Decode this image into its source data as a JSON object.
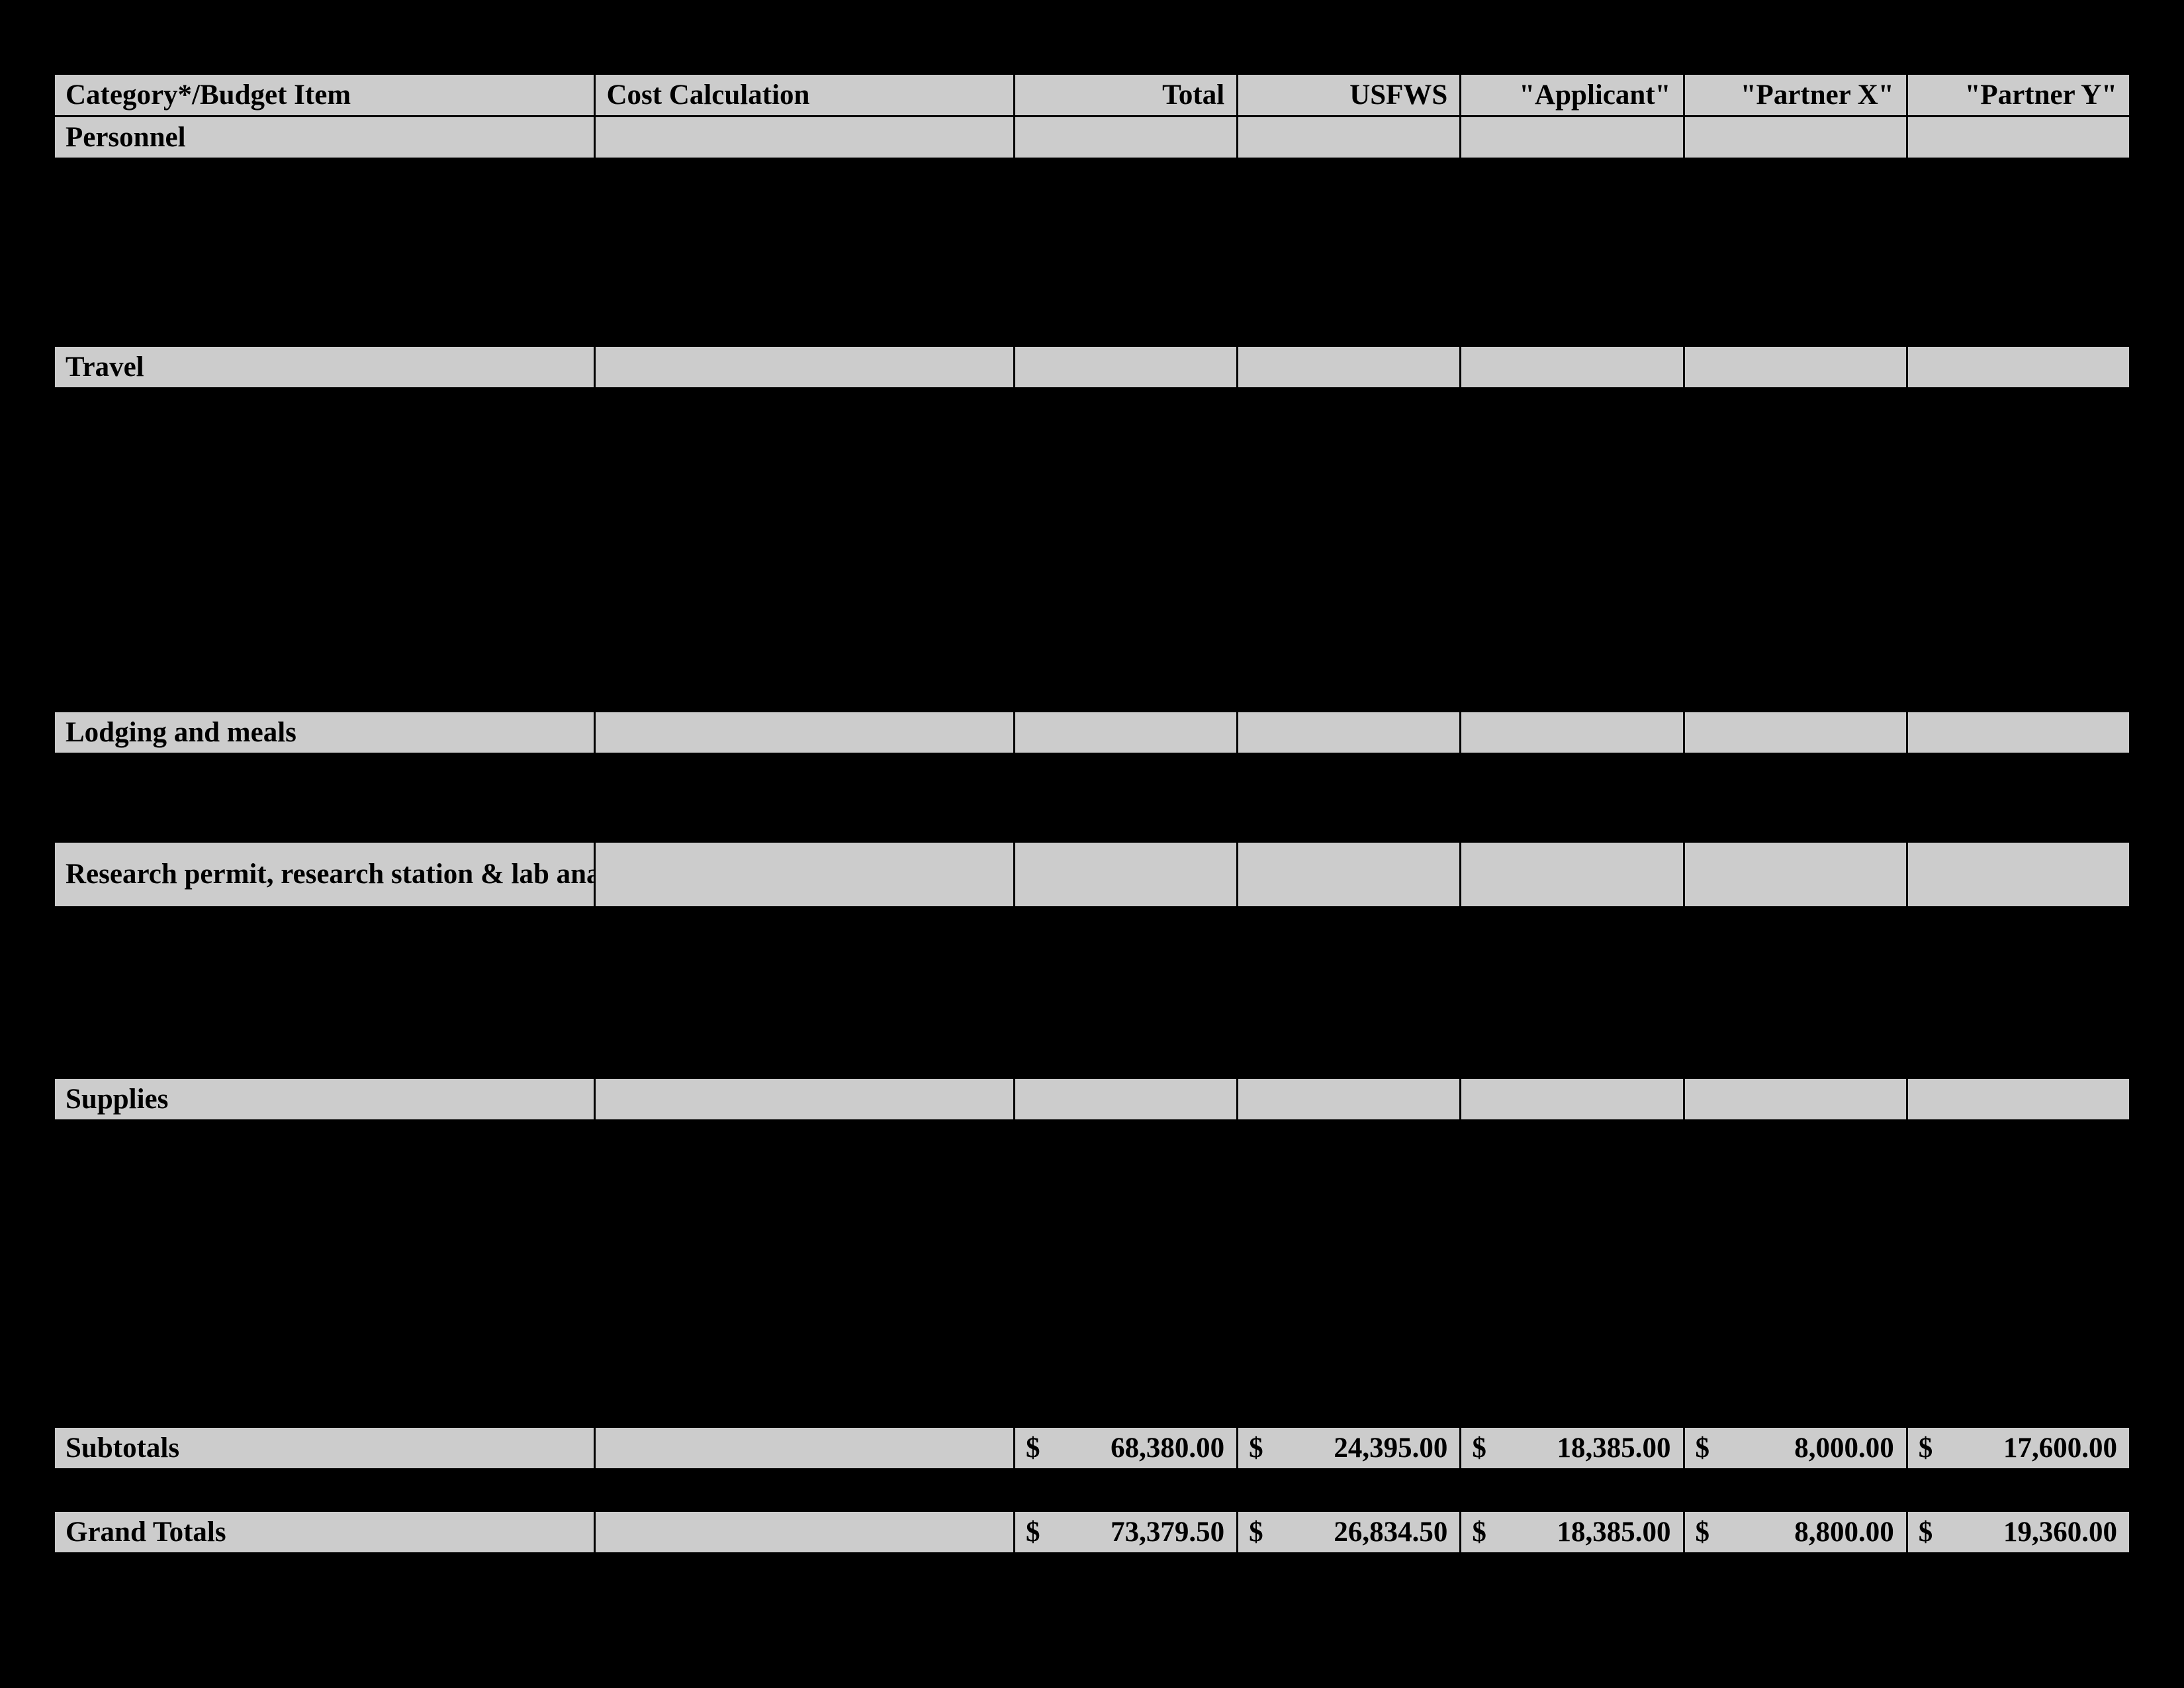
{
  "headers": {
    "category": "Category*/Budget Item",
    "calc": "Cost Calculation",
    "total": "Total",
    "usfws": "USFWS",
    "applicant": "\"Applicant\"",
    "partnerX": "\"Partner X\"",
    "partnerY": "\"Partner Y\""
  },
  "sections": {
    "personnel": "Personnel",
    "travel": "Travel",
    "lodging": "Lodging and meals",
    "fees": "Research permit, research station & lab analysis fees",
    "supplies": "Supplies",
    "subtotals": "Subtotals",
    "grandtotals": "Grand Totals"
  },
  "currency": "$",
  "subtotals": {
    "total": "68,380.00",
    "usfws": "24,395.00",
    "applicant": "18,385.00",
    "partnerX": "8,000.00",
    "partnerY": "17,600.00"
  },
  "grandtotals": {
    "total": "73,379.50",
    "usfws": "26,834.50",
    "applicant": "18,385.00",
    "partnerX": "8,800.00",
    "partnerY": "19,360.00"
  }
}
